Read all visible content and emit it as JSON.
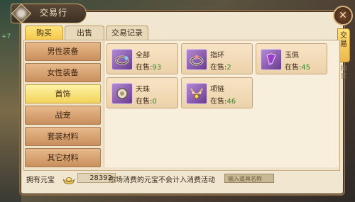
{
  "window": {
    "title": "交易行",
    "close_label": "✕"
  },
  "tabs": [
    {
      "label": "购买",
      "active": true
    },
    {
      "label": "出售",
      "active": false
    },
    {
      "label": "交易记录",
      "active": false
    }
  ],
  "side_tabs": [
    {
      "label": "交\n易",
      "active": true
    },
    {
      "label": "拍\n卖",
      "active": false
    }
  ],
  "left_indicator": "+7",
  "categories": [
    {
      "label": "男性装备",
      "active": false
    },
    {
      "label": "女性装备",
      "active": false
    },
    {
      "label": "首饰",
      "active": true
    },
    {
      "label": "战宠",
      "active": false
    },
    {
      "label": "套装材料",
      "active": false
    },
    {
      "label": "其它材料",
      "active": false
    }
  ],
  "items": [
    {
      "name": "全部",
      "sale_label": "在售:",
      "count": "93",
      "icon": "bracelet-icon"
    },
    {
      "name": "指环",
      "sale_label": "在售:",
      "count": "2",
      "icon": "ring-icon"
    },
    {
      "name": "玉佩",
      "sale_label": "在售:",
      "count": "45",
      "icon": "jade-pendant-icon"
    },
    {
      "name": "天珠",
      "sale_label": "在售:",
      "count": "0",
      "icon": "bead-icon"
    },
    {
      "name": "项链",
      "sale_label": "在售:",
      "count": "46",
      "icon": "necklace-icon"
    }
  ],
  "footer": {
    "currency_label": "拥有元宝",
    "currency_value": "28392",
    "notice": "市场消费的元宝不会计入消费活动",
    "search_placeholder": "输入道具名称"
  },
  "colors": {
    "accent": "#f4c74a",
    "count_green": "#2b8a2b",
    "icon_purple": "#6a3b8e"
  }
}
